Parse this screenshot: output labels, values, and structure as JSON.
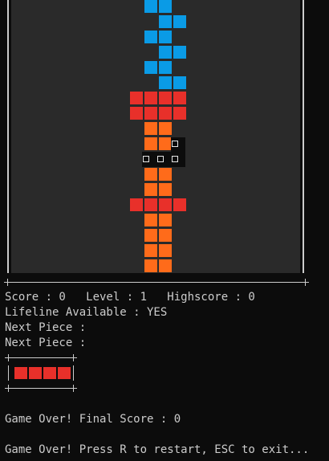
{
  "colors": {
    "cyan": "#0a9be6",
    "red": "#e8302a",
    "orange": "#ff6b1a",
    "board": "#2a2a2a",
    "terminal_bg": "#0c0c0c",
    "text": "#cccccc"
  },
  "status": {
    "score_line": "Score : 0   Level : 1   Highscore : 0",
    "lifeline_line": "Lifeline Available : YES",
    "next_piece_1": "Next Piece :",
    "next_piece_2": "Next Piece :",
    "final_score_line": "Game Over! Final Score : 0",
    "prompt_line": "Game Over! Press R to restart, ESC to exit..."
  },
  "next_piece": {
    "type": "I",
    "color": "red",
    "cells": 4
  }
}
